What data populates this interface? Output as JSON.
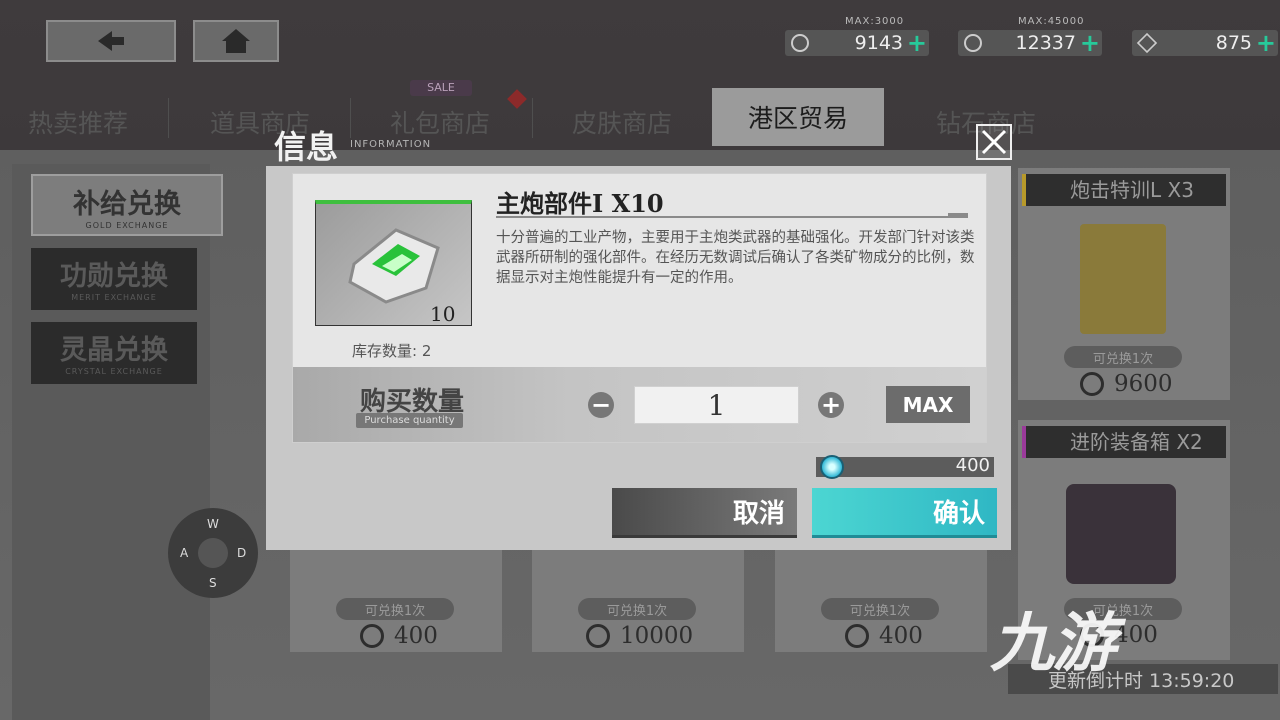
{
  "topbar": {
    "back_icon": "back-arrow-icon",
    "home_icon": "home-icon",
    "resources": [
      {
        "max": "MAX:3000",
        "value": "9143",
        "icon": "medal-icon"
      },
      {
        "max": "MAX:45000",
        "value": "12337",
        "icon": "gold-coin-icon"
      },
      {
        "max": "",
        "value": "875",
        "icon": "diamond-icon"
      }
    ]
  },
  "tabs": [
    {
      "label": "热卖推荐"
    },
    {
      "label": "道具商店"
    },
    {
      "label": "礼包商店",
      "badge": "SALE"
    },
    {
      "label": "皮肤商店"
    },
    {
      "label": "港区贸易",
      "active": true
    },
    {
      "label": "钻石商店"
    }
  ],
  "sidebar": [
    {
      "label": "补给兑换",
      "sub": "GOLD EXCHANGE",
      "active": true
    },
    {
      "label": "功勋兑换",
      "sub": "MERIT EXCHANGE"
    },
    {
      "label": "灵晶兑换",
      "sub": "CRYSTAL EXCHANGE"
    }
  ],
  "cards": {
    "top_right": {
      "title": "炮击特训L X3",
      "limit": "可兑换1次",
      "price": "9600"
    },
    "mid_right": {
      "title": "进阶装备箱 X2"
    },
    "bottom": [
      {
        "limit": "可兑换1次",
        "price": "400"
      },
      {
        "limit": "可兑换1次",
        "price": "10000"
      },
      {
        "limit": "可兑换1次",
        "price": "400"
      },
      {
        "limit": "可兑换1次",
        "price": "400"
      }
    ]
  },
  "dialog": {
    "title": "信息",
    "subtitle": "INFORMATION",
    "item_name": "主炮部件I X10",
    "item_count": "10",
    "stock": "库存数量: 2",
    "description": "十分普遍的工业产物，主要用于主炮类武器的基础强化。开发部门针对该类武器所研制的强化部件。在经历无数调试后确认了各类矿物成分的比例，数据显示对主炮性能提升有一定的作用。",
    "qty_label": "购买数量",
    "qty_label_en": "Purchase quantity",
    "qty_value": "1",
    "minus": "−",
    "plus": "+",
    "max_label": "MAX",
    "cost": "400",
    "cancel_label": "取消",
    "confirm_label": "确认"
  },
  "joystick": {
    "w": "W",
    "a": "A",
    "s": "S",
    "d": "D"
  },
  "watermark": "九游",
  "timer": "更新倒计时 13:59:20"
}
